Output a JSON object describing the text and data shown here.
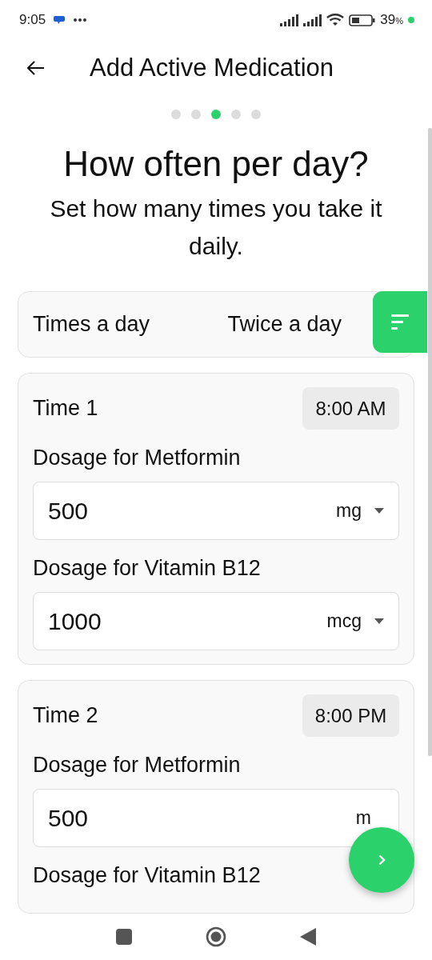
{
  "status_bar": {
    "time": "9:05",
    "battery_level_text": "39",
    "battery_unit": "%"
  },
  "header": {
    "title": "Add Active Medication"
  },
  "steps": [
    {
      "selected": false
    },
    {
      "selected": false
    },
    {
      "selected": true
    },
    {
      "selected": false
    },
    {
      "selected": false
    }
  ],
  "question": {
    "title": "How often per day?",
    "subtitle": "Set how many times you take it daily."
  },
  "frequency": {
    "label": "Times a day",
    "value": "Twice a day"
  },
  "times": [
    {
      "label": "Time 1",
      "time": "8:00 AM",
      "doses": [
        {
          "label": "Dosage for Metformin",
          "value": "500",
          "unit": "mg",
          "caret": true
        },
        {
          "label": "Dosage for Vitamin B12",
          "value": "1000",
          "unit": "mcg",
          "caret": true
        }
      ]
    },
    {
      "label": "Time 2",
      "time": "8:00 PM",
      "doses": [
        {
          "label": "Dosage for Metformin",
          "value": "500",
          "unit": "m",
          "caret": false
        },
        {
          "label": "Dosage for Vitamin B12"
        }
      ]
    }
  ]
}
